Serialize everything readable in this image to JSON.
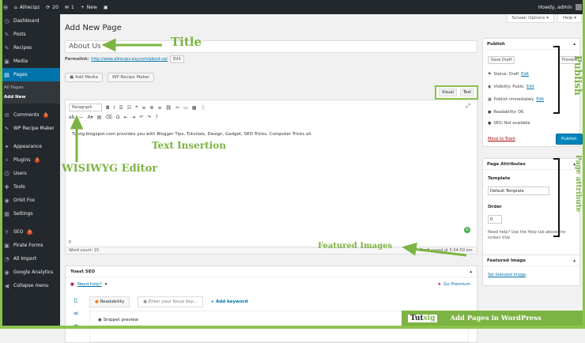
{
  "admin_bar": {
    "site_name": "Allrecipz",
    "updates_count": "20",
    "comments_count": "1",
    "new_label": "New",
    "howdy": "Howdy, admin"
  },
  "sidebar": {
    "items": [
      {
        "icon": "dashboard-icon",
        "glyph": "◷",
        "label": "Dashboard"
      },
      {
        "icon": "pin-icon",
        "glyph": "✎",
        "label": "Posts"
      },
      {
        "icon": "recipes-icon",
        "glyph": "✎",
        "label": "Recipes"
      },
      {
        "icon": "media-icon",
        "glyph": "▣",
        "label": "Media"
      },
      {
        "icon": "pages-icon",
        "glyph": "▤",
        "label": "Pages"
      }
    ],
    "pages_submenu": [
      "All Pages",
      "Add New"
    ],
    "items2": [
      {
        "icon": "comments-icon",
        "glyph": "✉",
        "label": "Comments",
        "badge": "1"
      },
      {
        "icon": "recipe-maker-icon",
        "glyph": "✎",
        "label": "WP Recipe Maker"
      }
    ],
    "items3": [
      {
        "icon": "appearance-icon",
        "glyph": "✦",
        "label": "Appearance"
      },
      {
        "icon": "plugins-icon",
        "glyph": "⚡",
        "label": "Plugins",
        "badge": "7"
      },
      {
        "icon": "users-icon",
        "glyph": "☺",
        "label": "Users"
      },
      {
        "icon": "tools-icon",
        "glyph": "✚",
        "label": "Tools"
      },
      {
        "icon": "orbit-fox-icon",
        "glyph": "◉",
        "label": "Orbit Fox"
      },
      {
        "icon": "settings-icon",
        "glyph": "▦",
        "label": "Settings"
      }
    ],
    "items4": [
      {
        "icon": "seo-icon",
        "glyph": "Y",
        "label": "SEO",
        "badge": "1"
      },
      {
        "icon": "pirate-forms-icon",
        "glyph": "▣",
        "label": "Pirate Forms"
      },
      {
        "icon": "all-import-icon",
        "glyph": "◔",
        "label": "All Import"
      },
      {
        "icon": "analytics-icon",
        "glyph": "◉",
        "label": "Google Analytics"
      },
      {
        "icon": "collapse-icon",
        "glyph": "◀",
        "label": "Collapse menu"
      }
    ]
  },
  "header": {
    "screen_options": "Screen Options ▾",
    "help": "Help ▾",
    "title": "Add New Page"
  },
  "editor": {
    "title_value": "About Us",
    "permalink_label": "Permalink:",
    "permalink_url": "http://www.allrecipz.esy.com/about-us/",
    "edit_label": "Edit",
    "add_media": "Add Media",
    "recipe_maker": "WP Recipe Maker",
    "tab_visual": "Visual",
    "tab_text": "Text",
    "format_select": "Paragraph",
    "content": "Tutsig.blogspot.com provides you with Blogger Tips, Tutorials, Design, Gadget, SEO Tricks, Computer Tricks all.",
    "path": "p",
    "word_count": "Word count: 15",
    "draft_saved": "Draft saved at 5:04:50 am."
  },
  "yoast": {
    "title": "Yoast SEO",
    "need_help": "Need help?",
    "go_premium": "Go Premium",
    "tab_readability": "Readability",
    "focus_placeholder": "Enter your focus key...",
    "add_keyword": "+ Add keyword",
    "snippet_preview": "Snippet preview"
  },
  "publish": {
    "title": "Publish",
    "save_draft": "Save Draft",
    "preview": "Preview",
    "status": "Status: Draft",
    "visibility": "Visibility: Public",
    "publish_time": "Publish immediately",
    "readability": "Readability: OK",
    "seo": "SEO: Not available",
    "edit": "Edit",
    "trash": "Move to Trash",
    "publish_btn": "Publish"
  },
  "page_attributes": {
    "title": "Page Attributes",
    "template_label": "Template",
    "template_value": "Default Template",
    "order_label": "Order",
    "order_value": "0",
    "help_text": "Need help? Use the Help tab above the screen title."
  },
  "featured_image": {
    "title": "Featured Image",
    "link": "Set featured image"
  },
  "annotations": {
    "title": "Title",
    "text_insertion": "Text Insertion",
    "wysiwyg": "WISIWYG Editor",
    "featured_images": "Featured Images",
    "publish": "Publish",
    "page_attribute": "Page attribute"
  },
  "footer": {
    "logo_part1": "Tut",
    "logo_part2": "sig",
    "caption": "Add Pages in WordPress"
  },
  "colors": {
    "annotation_green": "#7cb342",
    "wp_blue": "#0073aa",
    "admin_dark": "#23282d"
  }
}
